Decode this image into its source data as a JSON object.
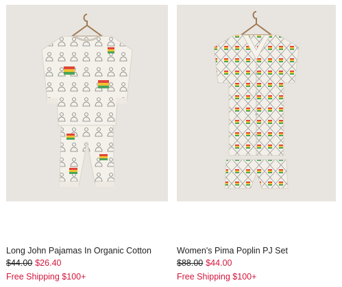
{
  "products": [
    {
      "title": "Long John Pajamas In Organic Cotton",
      "original_price": "$44.00",
      "sale_price": "$26.40",
      "shipping": "Free Shipping $100+"
    },
    {
      "title": "Women's Pima Poplin PJ Set",
      "original_price": "$88.00",
      "sale_price": "$44.00",
      "shipping": "Free Shipping $100+"
    }
  ],
  "colors": {
    "photo_background": "#e8e5e1",
    "sale_price": "#d2163c",
    "shipping": "#d2163c",
    "fabric": "#f4f1ea",
    "pattern_rainbow": [
      "#e0453a",
      "#f2c230",
      "#4aa55a"
    ]
  }
}
